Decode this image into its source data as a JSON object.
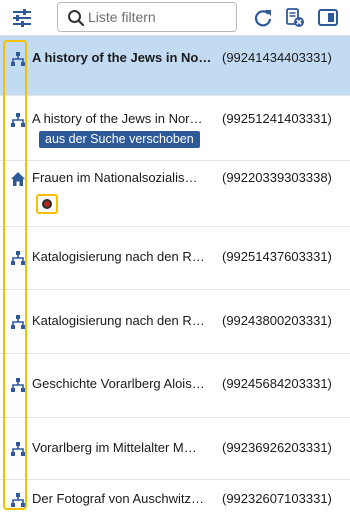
{
  "toolbar": {
    "filter_icon": "sliders-icon",
    "search_placeholder": "Liste filtern",
    "refresh_icon": "refresh-icon",
    "clear_filter_icon": "clear-filter-icon",
    "panel_icon": "panel-toggle-icon"
  },
  "rows": [
    {
      "title": "A history of the Jews in No…",
      "recid": "(99241434403331)",
      "icon": "hierarchy-icon",
      "selected": true
    },
    {
      "title": "A history of the Jews in Nor…",
      "recid": "(99251241403331)",
      "icon": "hierarchy-icon",
      "badge": "aus der Suche verschoben"
    },
    {
      "title": "Frauen im Nationalsozialis…",
      "recid": "(99220339303338)",
      "icon": "home-icon"
    },
    {
      "title": "Katalogisierung nach den R…",
      "recid": "(99251437603331)",
      "icon": "hierarchy-icon"
    },
    {
      "title": "Katalogisierung nach den R…",
      "recid": "(99243800203331)",
      "icon": "hierarchy-icon"
    },
    {
      "title": "Geschichte Vorarlberg Alois…",
      "recid": "(99245684203331)",
      "icon": "hierarchy-icon"
    },
    {
      "title": "Vorarlberg im Mittelalter M…",
      "recid": "(99236926203331)",
      "icon": "hierarchy-icon"
    },
    {
      "title": "Der Fotograf von Auschwitz…",
      "recid": "(99232607103331)",
      "icon": "hierarchy-icon"
    }
  ],
  "colors": {
    "selected_row": "#c2dbf3",
    "badge": "#2e5a9a",
    "highlight": "#f2c200",
    "icon": "#2e5a9a"
  }
}
